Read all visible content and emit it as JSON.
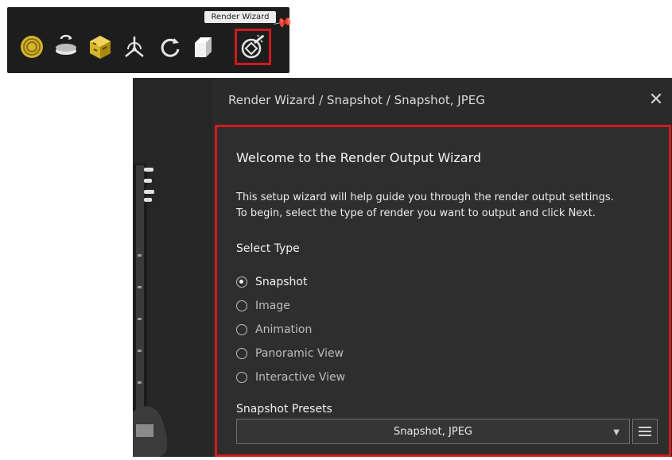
{
  "toolbar": {
    "title": "Render Wizard",
    "tools": [
      {
        "name": "environment-icon"
      },
      {
        "name": "turntable-icon"
      },
      {
        "name": "texture-cube-icon"
      },
      {
        "name": "camera-axis-icon"
      },
      {
        "name": "refresh-icon"
      },
      {
        "name": "3d-box-icon"
      },
      {
        "name": "render-wizard-icon",
        "selected": true
      }
    ]
  },
  "dialog": {
    "title": "Render Wizard / Snapshot / Snapshot, JPEG",
    "heading": "Welcome to the Render Output Wizard",
    "description_line1": "This setup wizard will help guide you through the render output settings.",
    "description_line2": "To begin, select the type of render you want to output and click Next.",
    "select_type_label": "Select Type",
    "types": [
      {
        "label": "Snapshot",
        "checked": true
      },
      {
        "label": "Image",
        "checked": false
      },
      {
        "label": "Animation",
        "checked": false
      },
      {
        "label": "Panoramic View",
        "checked": false
      },
      {
        "label": "Interactive View",
        "checked": false
      }
    ],
    "presets_label": "Snapshot Presets",
    "preset_value": "Snapshot, JPEG"
  },
  "colors": {
    "highlight": "#d11a1f",
    "gold": "#d5b52a",
    "dialog_bg": "#2a2a2a"
  }
}
